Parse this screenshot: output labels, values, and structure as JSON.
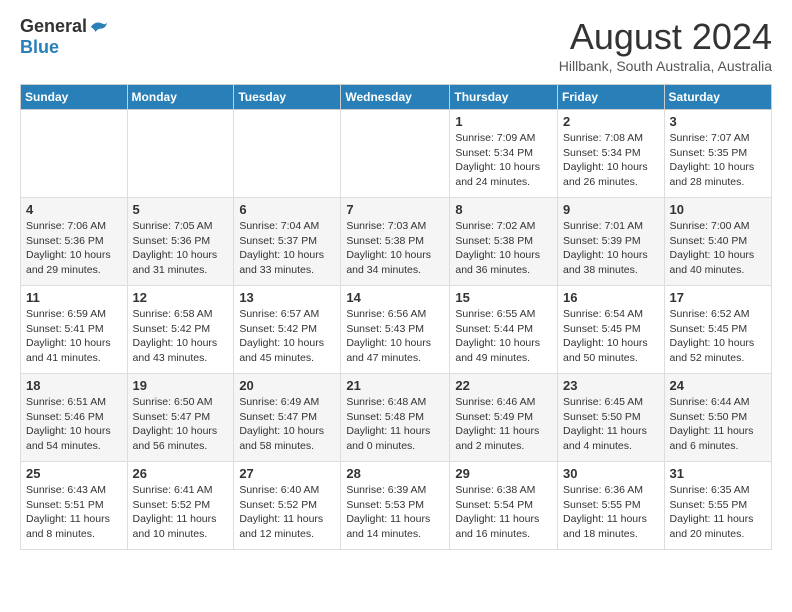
{
  "header": {
    "logo_general": "General",
    "logo_blue": "Blue",
    "month_year": "August 2024",
    "location": "Hillbank, South Australia, Australia"
  },
  "days_of_week": [
    "Sunday",
    "Monday",
    "Tuesday",
    "Wednesday",
    "Thursday",
    "Friday",
    "Saturday"
  ],
  "weeks": [
    [
      {
        "day": "",
        "info": ""
      },
      {
        "day": "",
        "info": ""
      },
      {
        "day": "",
        "info": ""
      },
      {
        "day": "",
        "info": ""
      },
      {
        "day": "1",
        "info": "Sunrise: 7:09 AM\nSunset: 5:34 PM\nDaylight: 10 hours\nand 24 minutes."
      },
      {
        "day": "2",
        "info": "Sunrise: 7:08 AM\nSunset: 5:34 PM\nDaylight: 10 hours\nand 26 minutes."
      },
      {
        "day": "3",
        "info": "Sunrise: 7:07 AM\nSunset: 5:35 PM\nDaylight: 10 hours\nand 28 minutes."
      }
    ],
    [
      {
        "day": "4",
        "info": "Sunrise: 7:06 AM\nSunset: 5:36 PM\nDaylight: 10 hours\nand 29 minutes."
      },
      {
        "day": "5",
        "info": "Sunrise: 7:05 AM\nSunset: 5:36 PM\nDaylight: 10 hours\nand 31 minutes."
      },
      {
        "day": "6",
        "info": "Sunrise: 7:04 AM\nSunset: 5:37 PM\nDaylight: 10 hours\nand 33 minutes."
      },
      {
        "day": "7",
        "info": "Sunrise: 7:03 AM\nSunset: 5:38 PM\nDaylight: 10 hours\nand 34 minutes."
      },
      {
        "day": "8",
        "info": "Sunrise: 7:02 AM\nSunset: 5:38 PM\nDaylight: 10 hours\nand 36 minutes."
      },
      {
        "day": "9",
        "info": "Sunrise: 7:01 AM\nSunset: 5:39 PM\nDaylight: 10 hours\nand 38 minutes."
      },
      {
        "day": "10",
        "info": "Sunrise: 7:00 AM\nSunset: 5:40 PM\nDaylight: 10 hours\nand 40 minutes."
      }
    ],
    [
      {
        "day": "11",
        "info": "Sunrise: 6:59 AM\nSunset: 5:41 PM\nDaylight: 10 hours\nand 41 minutes."
      },
      {
        "day": "12",
        "info": "Sunrise: 6:58 AM\nSunset: 5:42 PM\nDaylight: 10 hours\nand 43 minutes."
      },
      {
        "day": "13",
        "info": "Sunrise: 6:57 AM\nSunset: 5:42 PM\nDaylight: 10 hours\nand 45 minutes."
      },
      {
        "day": "14",
        "info": "Sunrise: 6:56 AM\nSunset: 5:43 PM\nDaylight: 10 hours\nand 47 minutes."
      },
      {
        "day": "15",
        "info": "Sunrise: 6:55 AM\nSunset: 5:44 PM\nDaylight: 10 hours\nand 49 minutes."
      },
      {
        "day": "16",
        "info": "Sunrise: 6:54 AM\nSunset: 5:45 PM\nDaylight: 10 hours\nand 50 minutes."
      },
      {
        "day": "17",
        "info": "Sunrise: 6:52 AM\nSunset: 5:45 PM\nDaylight: 10 hours\nand 52 minutes."
      }
    ],
    [
      {
        "day": "18",
        "info": "Sunrise: 6:51 AM\nSunset: 5:46 PM\nDaylight: 10 hours\nand 54 minutes."
      },
      {
        "day": "19",
        "info": "Sunrise: 6:50 AM\nSunset: 5:47 PM\nDaylight: 10 hours\nand 56 minutes."
      },
      {
        "day": "20",
        "info": "Sunrise: 6:49 AM\nSunset: 5:47 PM\nDaylight: 10 hours\nand 58 minutes."
      },
      {
        "day": "21",
        "info": "Sunrise: 6:48 AM\nSunset: 5:48 PM\nDaylight: 11 hours\nand 0 minutes."
      },
      {
        "day": "22",
        "info": "Sunrise: 6:46 AM\nSunset: 5:49 PM\nDaylight: 11 hours\nand 2 minutes."
      },
      {
        "day": "23",
        "info": "Sunrise: 6:45 AM\nSunset: 5:50 PM\nDaylight: 11 hours\nand 4 minutes."
      },
      {
        "day": "24",
        "info": "Sunrise: 6:44 AM\nSunset: 5:50 PM\nDaylight: 11 hours\nand 6 minutes."
      }
    ],
    [
      {
        "day": "25",
        "info": "Sunrise: 6:43 AM\nSunset: 5:51 PM\nDaylight: 11 hours\nand 8 minutes."
      },
      {
        "day": "26",
        "info": "Sunrise: 6:41 AM\nSunset: 5:52 PM\nDaylight: 11 hours\nand 10 minutes."
      },
      {
        "day": "27",
        "info": "Sunrise: 6:40 AM\nSunset: 5:52 PM\nDaylight: 11 hours\nand 12 minutes."
      },
      {
        "day": "28",
        "info": "Sunrise: 6:39 AM\nSunset: 5:53 PM\nDaylight: 11 hours\nand 14 minutes."
      },
      {
        "day": "29",
        "info": "Sunrise: 6:38 AM\nSunset: 5:54 PM\nDaylight: 11 hours\nand 16 minutes."
      },
      {
        "day": "30",
        "info": "Sunrise: 6:36 AM\nSunset: 5:55 PM\nDaylight: 11 hours\nand 18 minutes."
      },
      {
        "day": "31",
        "info": "Sunrise: 6:35 AM\nSunset: 5:55 PM\nDaylight: 11 hours\nand 20 minutes."
      }
    ]
  ]
}
